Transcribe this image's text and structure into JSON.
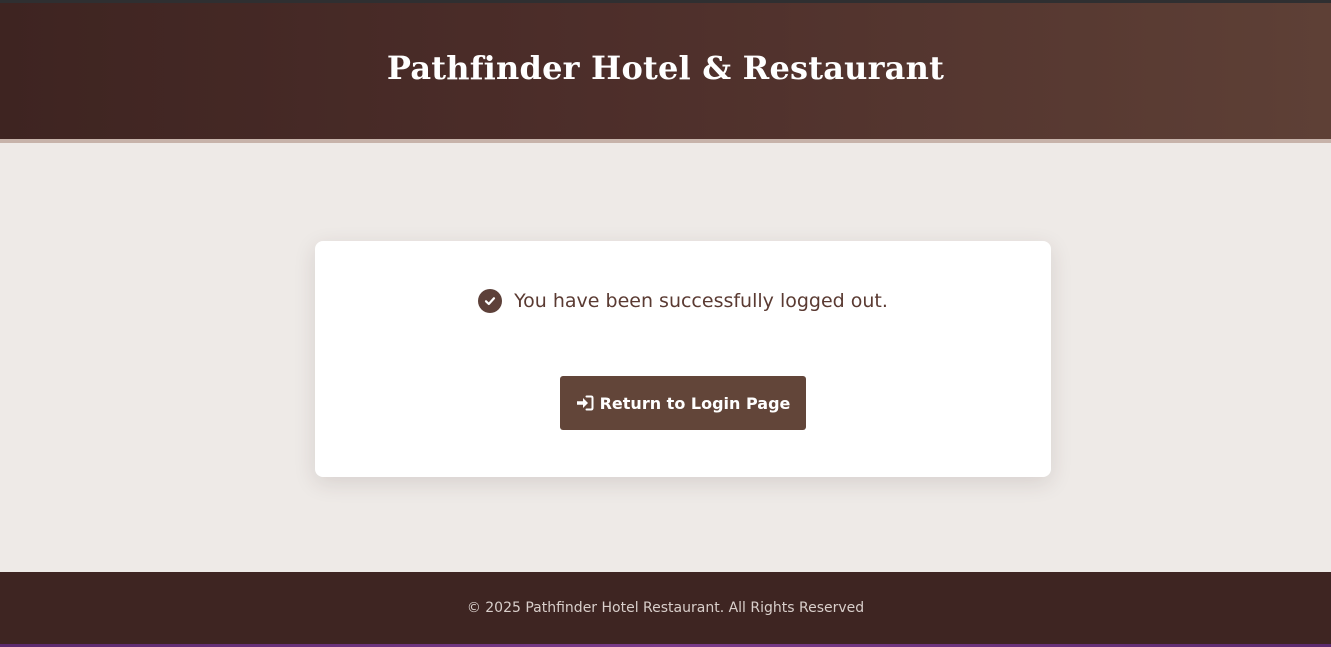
{
  "header": {
    "title": "Pathfinder Hotel & Restaurant"
  },
  "logout_card": {
    "message": "You have been successfully logged out.",
    "message_icon": "check-circle-icon",
    "button": {
      "label": "Return to Login Page",
      "icon": "sign-in-icon"
    }
  },
  "footer": {
    "copyright": "© 2025 Pathfinder Hotel Restaurant. All Rights Reserved"
  },
  "colors": {
    "header_bg": "#4d2e2a",
    "accent": "#624539",
    "page_bg": "#eeeae7",
    "footer_bg": "#3e2522",
    "message_text": "#5a3a32"
  }
}
